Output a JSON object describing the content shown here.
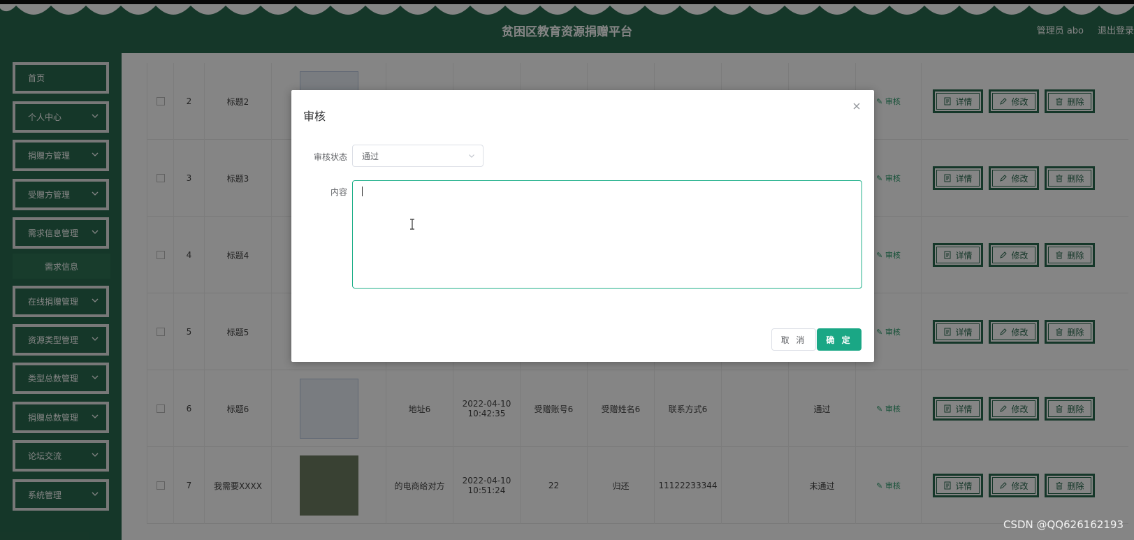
{
  "header": {
    "title": "贫困区教育资源捐赠平台",
    "admin": "管理员 abo",
    "logout": "退出登录"
  },
  "sidebar": {
    "items": [
      {
        "label": "首页",
        "expandable": false
      },
      {
        "label": "个人中心",
        "expandable": true
      },
      {
        "label": "捐赠方管理",
        "expandable": true
      },
      {
        "label": "受赠方管理",
        "expandable": true
      },
      {
        "label": "需求信息管理",
        "expandable": true
      },
      {
        "label": "在线捐赠管理",
        "expandable": true
      },
      {
        "label": "资源类型管理",
        "expandable": true
      },
      {
        "label": "类型总数管理",
        "expandable": true
      },
      {
        "label": "捐赠总数管理",
        "expandable": true
      },
      {
        "label": "论坛交流",
        "expandable": true
      },
      {
        "label": "系统管理",
        "expandable": true
      }
    ],
    "submenu": {
      "label": "需求信息"
    }
  },
  "table": {
    "rows": [
      {
        "index": "2",
        "title": "标题2",
        "address": "",
        "time": "",
        "account": "",
        "name": "",
        "contact": "",
        "status": ""
      },
      {
        "index": "3",
        "title": "标题3",
        "address": "",
        "time": "",
        "account": "",
        "name": "",
        "contact": "",
        "status": ""
      },
      {
        "index": "4",
        "title": "标题4",
        "address": "",
        "time": "",
        "account": "",
        "name": "",
        "contact": "",
        "status": ""
      },
      {
        "index": "5",
        "title": "标题5",
        "address": "",
        "time": "",
        "account": "",
        "name": "",
        "contact": "",
        "status": ""
      },
      {
        "index": "6",
        "title": "标题6",
        "address": "地址6",
        "time": "2022-04-10 10:42:35",
        "account": "受赠账号6",
        "name": "受赠姓名6",
        "contact": "联系方式6",
        "status": "通过"
      },
      {
        "index": "7",
        "title": "我需要XXXX",
        "address": "的电商给对方",
        "time": "2022-04-10 10:51:24",
        "account": "22",
        "name": "归还",
        "contact": "11122233344",
        "status": "未通过"
      }
    ],
    "audit_link": "审核",
    "actions": {
      "detail": "详情",
      "edit": "修改",
      "delete": "删除"
    }
  },
  "dialog": {
    "title": "审核",
    "status_label": "审核状态",
    "status_value": "通过",
    "content_label": "内容",
    "content_value": "",
    "cancel": "取 消",
    "confirm": "确 定"
  },
  "watermark": "CSDN @QQ626162193",
  "colors": {
    "primary": "#2a6a4f",
    "accent": "#1aa785"
  }
}
